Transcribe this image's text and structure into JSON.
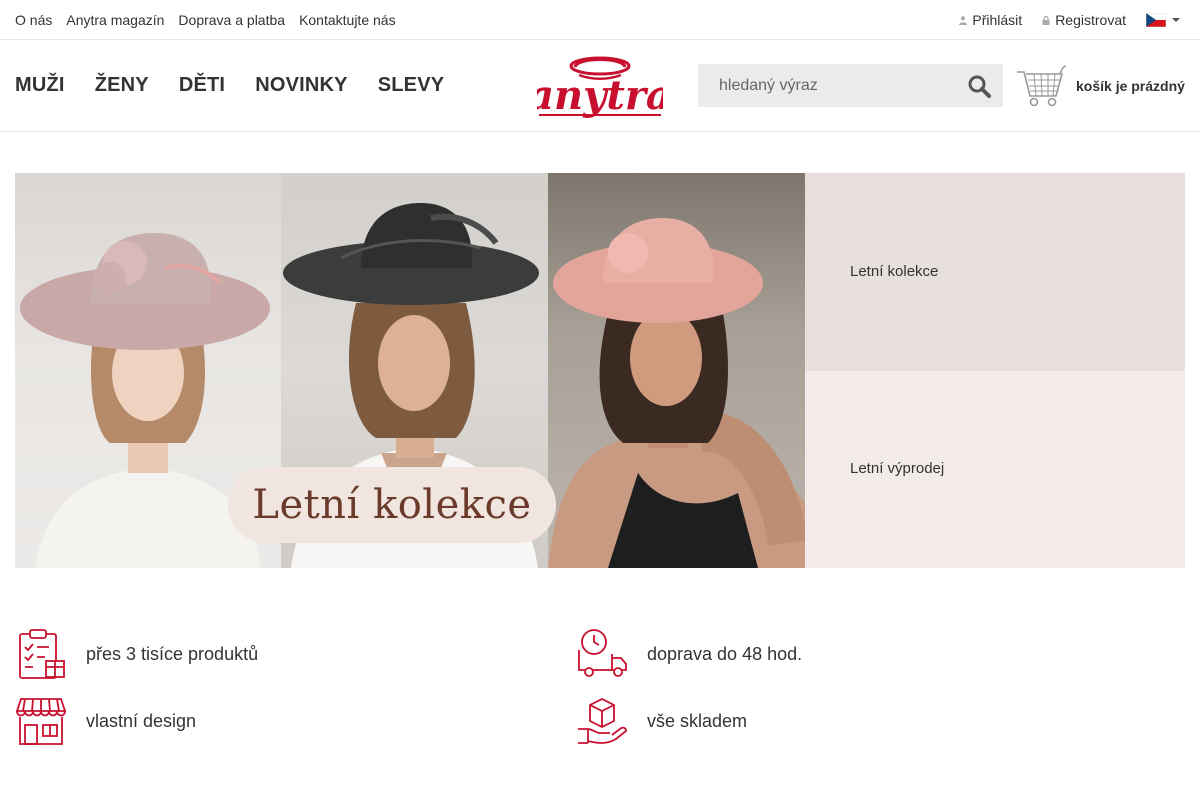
{
  "topbar": {
    "links": [
      "O nás",
      "Anytra magazín",
      "Doprava a platba",
      "Kontaktujte nás"
    ],
    "login": "Přihlásit",
    "register": "Registrovat",
    "language_icon": "czech-flag-icon"
  },
  "nav": {
    "items": [
      "MUŽI",
      "ŽENY",
      "DĚTI",
      "NOVINKY",
      "SLEVY"
    ]
  },
  "logo": {
    "text": "anytra",
    "color": "#c8102e"
  },
  "search": {
    "placeholder": "hledaný výraz",
    "icon": "search-icon"
  },
  "cart": {
    "label": "košík je prázdný",
    "icon": "cart-icon"
  },
  "hero": {
    "banner_text": "Letní kolekce",
    "side_links": [
      "Letní kolekce",
      "Letní výprodej"
    ]
  },
  "features": [
    {
      "icon": "clipboard-gift-icon",
      "label": "přes 3 tisíce produktů"
    },
    {
      "icon": "delivery-truck-icon",
      "label": "doprava do 48 hod."
    },
    {
      "icon": "storefront-icon",
      "label": "vlastní design"
    },
    {
      "icon": "hand-box-icon",
      "label": "vše skladem"
    }
  ],
  "colors": {
    "accent": "#c8102e",
    "text": "#333333",
    "search_bg": "#ebebeb"
  }
}
